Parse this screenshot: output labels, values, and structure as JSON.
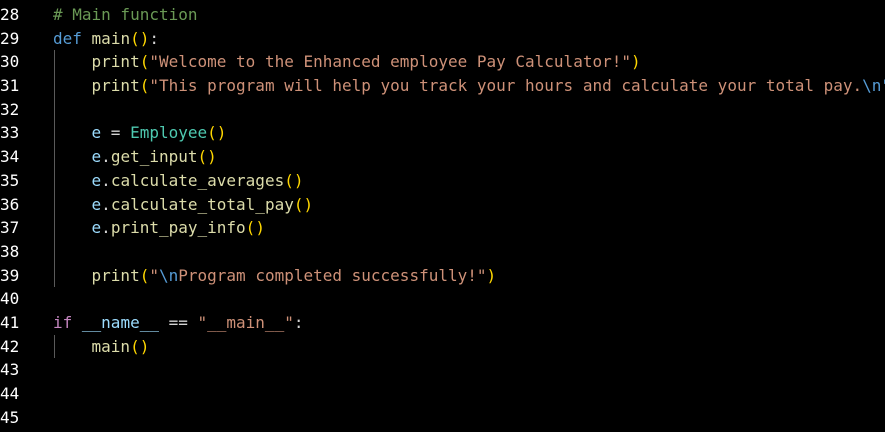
{
  "line_numbers": [
    "28",
    "29",
    "30",
    "31",
    "32",
    "33",
    "34",
    "35",
    "36",
    "37",
    "38",
    "39",
    "40",
    "41",
    "42",
    "43",
    "44",
    "45"
  ],
  "code": {
    "l28": {
      "comment": "# Main function"
    },
    "l29": {
      "kw": "def",
      "name": "main",
      "open": "(",
      "close": ")",
      "colon": ":"
    },
    "l30": {
      "indent": "    ",
      "fn": "print",
      "open": "(",
      "str": "\"Welcome to the Enhanced employee Pay Calculator!\"",
      "close": ")"
    },
    "l31": {
      "indent": "    ",
      "fn": "print",
      "open": "(",
      "str": "\"This program will help you track your hours and calculate your total pay.",
      "esc": "\\n\""
    },
    "l33": {
      "indent": "    ",
      "var": "e",
      "eq": " = ",
      "cls": "Employee",
      "open": "(",
      "close": ")"
    },
    "l34": {
      "indent": "    ",
      "var": "e",
      "dot": ".",
      "fn": "get_input",
      "open": "(",
      "close": ")"
    },
    "l35": {
      "indent": "    ",
      "var": "e",
      "dot": ".",
      "fn": "calculate_averages",
      "open": "(",
      "close": ")"
    },
    "l36": {
      "indent": "    ",
      "var": "e",
      "dot": ".",
      "fn": "calculate_total_pay",
      "open": "(",
      "close": ")"
    },
    "l37": {
      "indent": "    ",
      "var": "e",
      "dot": ".",
      "fn": "print_pay_info",
      "open": "(",
      "close": ")"
    },
    "l39": {
      "indent": "    ",
      "fn": "print",
      "open": "(",
      "str_q": "\"",
      "esc": "\\n",
      "str": "Program completed successfully!\"",
      "close": ")"
    },
    "l41": {
      "kw": "if",
      "sp": " ",
      "var": "__name__",
      "op": " == ",
      "str": "\"__main__\"",
      "colon": ":"
    },
    "l42": {
      "indent": "    ",
      "fn": "main",
      "open": "(",
      "close": ")"
    }
  },
  "colors": {
    "background": "#000000",
    "comment": "#6a9955",
    "keyword": "#569cd6",
    "control_keyword": "#c586c0",
    "function": "#dcdcaa",
    "string": "#ce9178",
    "class": "#4ec9b0",
    "variable": "#9cdcfe",
    "bracket_level1": "#ffd700",
    "bracket_level2": "#da70d6"
  }
}
